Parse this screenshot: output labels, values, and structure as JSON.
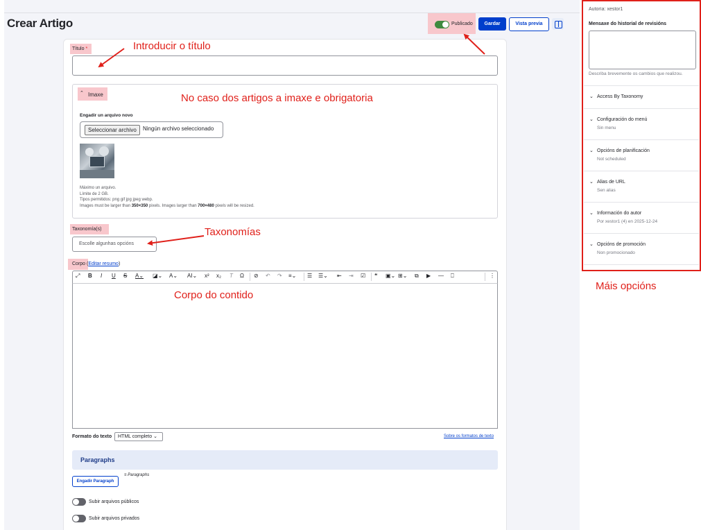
{
  "header": {
    "title": "Crear Artigo",
    "published_label": "Publicado",
    "save_label": "Gardar",
    "preview_label": "Vista previa"
  },
  "form": {
    "title_label": "Título",
    "required_mark": "*",
    "image": {
      "summary": "Imaxe",
      "add_label": "Engadir un arquivo novo",
      "file_button": "Seleccionar archivo",
      "file_status": "Ningún archivo seleccionado",
      "help_1": "Máximo un arquivo.",
      "help_2": "Límite de 2 GB.",
      "help_3": "Tipos permitidos: png gif jpg jpeg webp.",
      "help_4_pre": "Images must be larger than ",
      "help_4_min": "350×350",
      "help_4_mid": " pixels. Images larger than ",
      "help_4_max": "700×480",
      "help_4_post": " pixels will be resized."
    },
    "taxonomy_label": "Taxonomía(s)",
    "taxonomy_placeholder": "Escolle algunhas opcións",
    "body_label": "Corpo",
    "body_edit_summary": "Editar resumo",
    "text_format_label": "Formato do texto",
    "text_format_value": "HTML completo",
    "formats_link": "Sobre os formatos de texto",
    "paragraphs_title": "Paragraphs",
    "add_paragraph": "Engadir Paragraph",
    "paragraph_type": "Paragraphs",
    "public_files": "Subir arquivos públicos",
    "private_files": "Subir arquivos privados"
  },
  "sidebar": {
    "author_top": "Autoría: xestor1",
    "revision_label": "Mensaxe do historial de revisións",
    "revision_help": "Describa brevemente os cambios que realizou.",
    "items": [
      {
        "title": "Access By Taxonomy",
        "sub": ""
      },
      {
        "title": "Configuración do menú",
        "sub": "Sin menu"
      },
      {
        "title": "Opcións de planificación",
        "sub": "Not scheduled"
      },
      {
        "title": "Alias de URL",
        "sub": "Sen alias"
      },
      {
        "title": "Información do autor",
        "sub": "Por xestor1 (4) en 2025-12-24"
      },
      {
        "title": "Opcións de promoción",
        "sub": "Non promocionado"
      }
    ]
  },
  "annotations": {
    "title": "Introducir o título",
    "image": "No caso dos artigos a imaxe e obrigatoria",
    "taxonomy": "Taxonomías",
    "body": "Corpo do contido",
    "more": "Máis opcións"
  },
  "colors": {
    "accent": "#003ecc",
    "annotation": "#e0201a",
    "highlight": "#f8c7cc",
    "toggle_on": "#3f8a3f"
  }
}
